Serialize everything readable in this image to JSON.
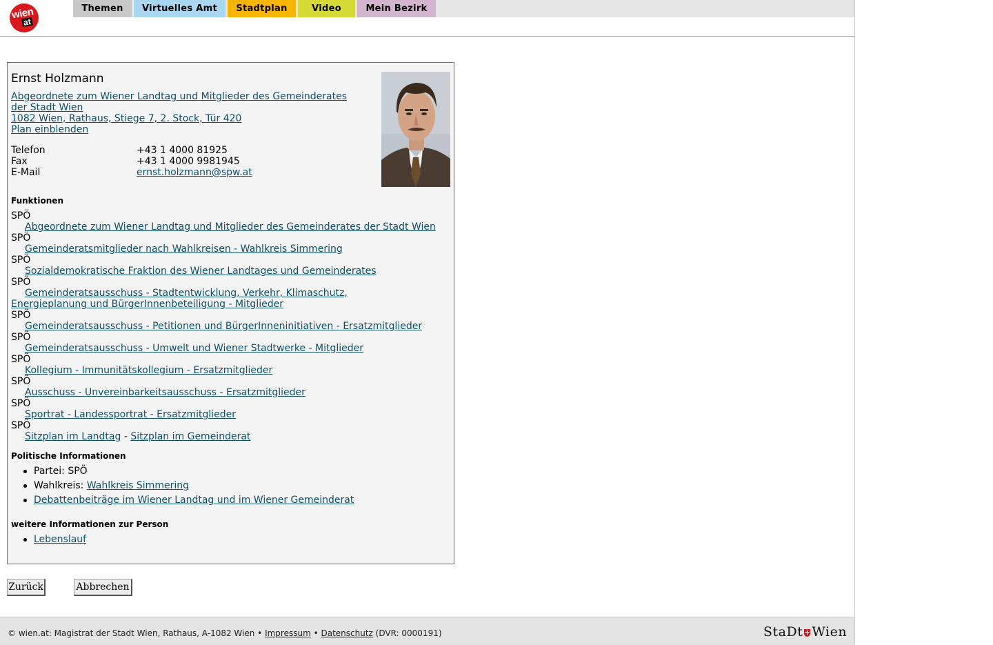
{
  "header": {
    "logo": {
      "line1": "wien",
      "line2": "at"
    },
    "nav": [
      {
        "label": "Themen",
        "color": "#c8c8c8"
      },
      {
        "label": "Virtuelles Amt",
        "color": "#a9d6f0"
      },
      {
        "label": "Stadtplan",
        "color": "#f7b500"
      },
      {
        "label": "Video",
        "color": "#d7da36"
      },
      {
        "label": "Mein Bezirk",
        "color": "#d2b4cf"
      }
    ]
  },
  "person": {
    "name": "Ernst Holzmann",
    "role_link": "Abgeordnete zum Wiener Landtag und Mitglieder des Gemeinderates der Stadt Wien",
    "address": "1082 Wien, Rathaus, Stiege 7, 2. Stock, Tür 420",
    "plan_link": "Plan einblenden",
    "contact": [
      {
        "label": "Telefon",
        "value": "+43 1 4000 81925"
      },
      {
        "label": "Fax",
        "value": "+43 1 4000 9981945"
      },
      {
        "label": "E-Mail",
        "value": "ernst.holzmann@spw.at"
      }
    ]
  },
  "functions": {
    "heading": "Funktionen",
    "items": [
      {
        "party": "SPÖ",
        "link": "Abgeordnete zum Wiener Landtag und Mitglieder des Gemeinderates der Stadt Wien"
      },
      {
        "party": "SPÖ",
        "link": "Gemeinderatsmitglieder nach Wahlkreisen - Wahlkreis Simmering"
      },
      {
        "party": "SPÖ",
        "link": "Sozialdemokratische Fraktion des Wiener Landtages und Gemeinderates"
      },
      {
        "party": "SPÖ",
        "link": "Gemeinderatsausschuss - Stadtentwicklung, Verkehr, Klimaschutz, Energieplanung und BürgerInnenbeteiligung - Mitglieder"
      },
      {
        "party": "SPÖ",
        "link": "Gemeinderatsausschuss - Petitionen und BürgerInneninitiativen - Ersatzmitglieder"
      },
      {
        "party": "SPÖ",
        "link": "Gemeinderatsausschuss - Umwelt und Wiener Stadtwerke - Mitglieder"
      },
      {
        "party": "SPÖ",
        "link": "Kollegium - Immunitätskollegium - Ersatzmitglieder"
      },
      {
        "party": "SPÖ",
        "link": "Ausschuss - Unvereinbarkeitsausschuss - Ersatzmitglieder"
      },
      {
        "party": "SPÖ",
        "link": "Sportrat - Landessportrat - Ersatzmitglieder"
      }
    ],
    "last": {
      "party": "SPÖ",
      "link1": "Sitzplan im Landtag",
      "separator": " - ",
      "link2": "Sitzplan im Gemeinderat"
    }
  },
  "political": {
    "heading": "Politische Informationen",
    "party_label": "Partei: ",
    "party_value": "SPÖ",
    "district_label": "Wahlkreis: ",
    "district_link": "Wahlkreis Simmering",
    "debates_link": "Debattenbeiträge im Wiener Landtag und im Wiener Gemeinderat"
  },
  "more": {
    "heading": "weitere Informationen zur Person",
    "cv_link": "Lebenslauf"
  },
  "buttons": {
    "back": "Zurück",
    "cancel": "Abbrechen"
  },
  "footer": {
    "copyright": "© wien.at: Magistrat der Stadt Wien, Rathaus, A-1082 Wien • ",
    "impressum": "Impressum",
    "sep": " • ",
    "datenschutz": "Datenschutz",
    "dvr": " (DVR: 0000191)",
    "logo_left": "StaDt",
    "logo_right": "Wien"
  }
}
